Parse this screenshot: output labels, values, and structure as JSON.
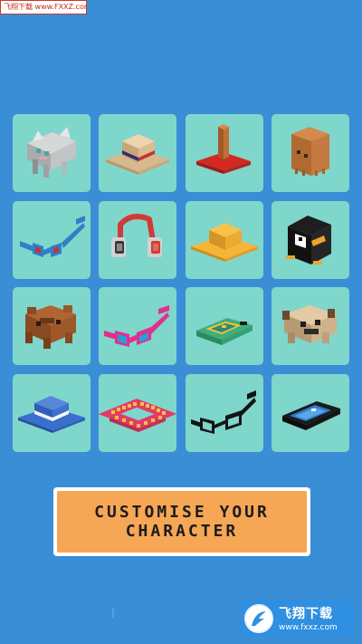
{
  "watermark_top": {
    "text": "飞翔下载 www.FXXZ.com"
  },
  "items": [
    {
      "name": "Cat hood"
    },
    {
      "name": "Straw hat"
    },
    {
      "name": "Red top hat"
    },
    {
      "name": "Paper bag"
    },
    {
      "name": "Blue glasses"
    },
    {
      "name": "Headphones"
    },
    {
      "name": "Yellow sun hat"
    },
    {
      "name": "Penguin hood"
    },
    {
      "name": "Bear hood"
    },
    {
      "name": "Pink glasses"
    },
    {
      "name": "Green goggles"
    },
    {
      "name": "Dog hood"
    },
    {
      "name": "Blue bowler hat"
    },
    {
      "name": "Flower crown"
    },
    {
      "name": "Black glasses"
    },
    {
      "name": "Ski goggles"
    }
  ],
  "banner": {
    "line1": "CUSTOMISE YOUR",
    "line2": "CHARACTER"
  },
  "watermark_bottom": {
    "title": "飞翔下载",
    "url": "www.fxxz.com"
  },
  "colors": {
    "background": "#3a8ed6",
    "tile": "#7fd6cb",
    "banner": "#f6a755"
  }
}
